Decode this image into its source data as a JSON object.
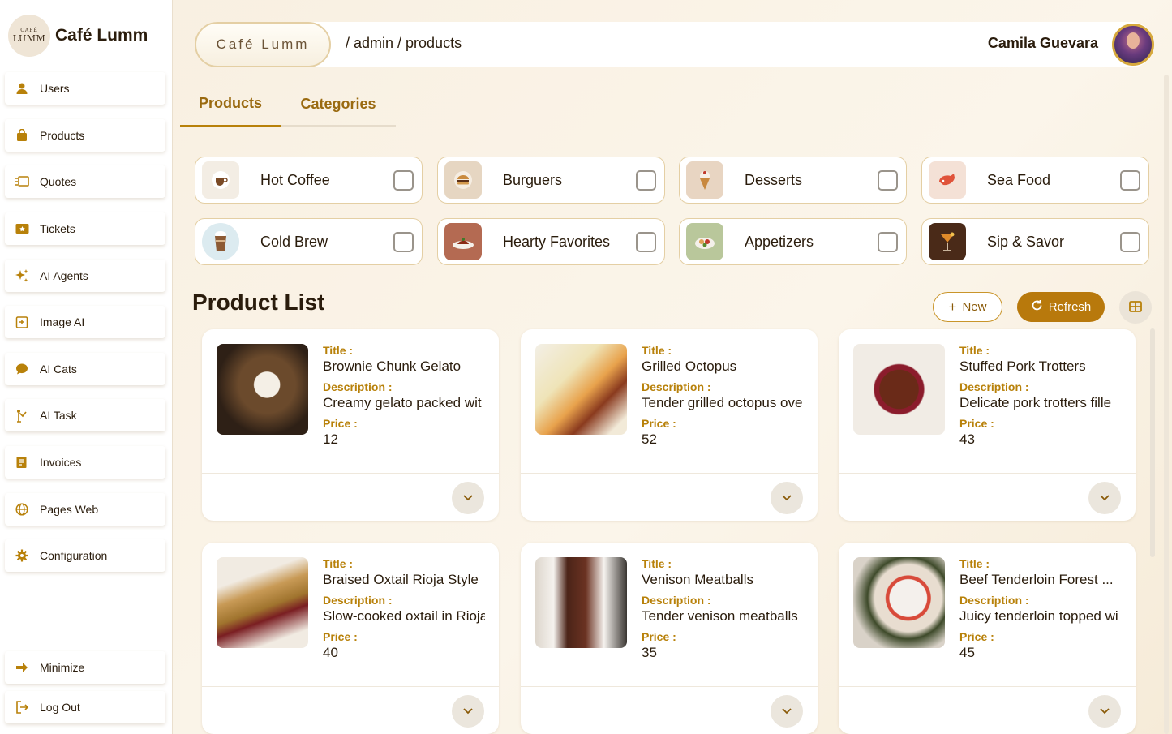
{
  "brand": {
    "logo_top": "CAFÉ",
    "logo_bottom": "LUMM",
    "name": "Café Lumm"
  },
  "sidebar": {
    "items": [
      {
        "label": "Users",
        "icon": "user-icon"
      },
      {
        "label": "Products",
        "icon": "bag-icon"
      },
      {
        "label": "Quotes",
        "icon": "quotes-icon"
      },
      {
        "label": "Tickets",
        "icon": "ticket-icon"
      },
      {
        "label": "AI Agents",
        "icon": "sparkle-icon"
      },
      {
        "label": "Image AI",
        "icon": "image-ai-icon"
      },
      {
        "label": "AI Cats",
        "icon": "chat-icon"
      },
      {
        "label": "AI Task",
        "icon": "task-icon"
      },
      {
        "label": "Invoices",
        "icon": "invoice-icon"
      },
      {
        "label": "Pages Web",
        "icon": "globe-icon"
      },
      {
        "label": "Configuration",
        "icon": "gear-icon"
      }
    ],
    "minimize": "Minimize",
    "logout": "Log Out"
  },
  "header": {
    "pill": "Café Lumm",
    "breadcrumb": "/ admin / products",
    "user": "Camila Guevara"
  },
  "tabs": [
    {
      "label": "Products",
      "active": true
    },
    {
      "label": "Categories",
      "active": false
    }
  ],
  "categories": [
    {
      "label": "Hot Coffee",
      "icon": "coffee-icon",
      "bg": "#f3ede4"
    },
    {
      "label": "Burguers",
      "icon": "burger-icon",
      "bg": "#e6d6c2"
    },
    {
      "label": "Desserts",
      "icon": "dessert-icon",
      "bg": "#e8d5c2"
    },
    {
      "label": "Sea Food",
      "icon": "seafood-icon",
      "bg": "#f4e1d6"
    },
    {
      "label": "Cold Brew",
      "icon": "cold-brew-icon",
      "bg": "#dcebf0"
    },
    {
      "label": "Hearty Favorites",
      "icon": "hearty-icon",
      "bg": "#b46a52"
    },
    {
      "label": "Appetizers",
      "icon": "appetizer-icon",
      "bg": "#b9c79b"
    },
    {
      "label": "Sip & Savor",
      "icon": "cocktail-icon",
      "bg": "#4a2a18"
    }
  ],
  "product_list": {
    "title": "Product List",
    "new_label": "New",
    "refresh_label": "Refresh",
    "field_labels": {
      "title": "Title :",
      "description": "Description :",
      "price": "Price :"
    },
    "products": [
      {
        "title": "Brownie Chunk Gelato",
        "description": "Creamy gelato packed wit",
        "price": "12",
        "img_color": "#4a3320"
      },
      {
        "title": "Grilled Octopus",
        "description": "Tender grilled octopus ove",
        "price": "52",
        "img_color": "#e8c77e"
      },
      {
        "title": "Stuffed Pork Trotters",
        "description": "Delicate pork trotters fille",
        "price": "43",
        "img_color": "#5a2418"
      },
      {
        "title": "Braised Oxtail Rioja Style",
        "description": "Slow-cooked oxtail in Rioja",
        "price": "40",
        "img_color": "#b98a4c"
      },
      {
        "title": "Venison Meatballs",
        "description": "Tender venison meatballs",
        "price": "35",
        "img_color": "#4b2418"
      },
      {
        "title": "Beef Tenderloin Forest ...",
        "description": "Juicy tenderloin topped wi",
        "price": "45",
        "img_color": "#d8cfc4"
      }
    ]
  },
  "colors": {
    "accent": "#b8810a",
    "refresh_bg": "#b8790c"
  }
}
